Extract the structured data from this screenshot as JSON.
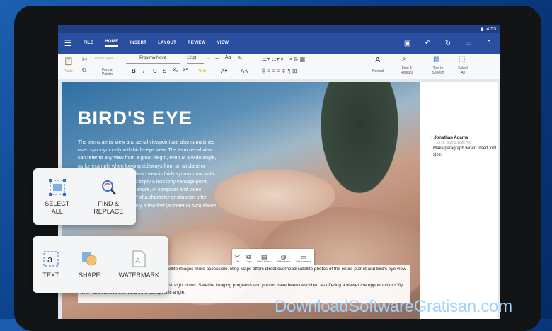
{
  "status": {
    "time": "4:53"
  },
  "menu": {
    "items": [
      "FILE",
      "HOME",
      "INSERT",
      "LAYOUT",
      "REVIEW",
      "VIEW"
    ]
  },
  "ribbon": {
    "paste": "Paste",
    "paste_style": "Paste Style",
    "format_painter": "Format Painter",
    "font_name": "Proxima Nova",
    "font_size": "12 pt",
    "style_normal": "Normal",
    "find_replace": "Find & Replace",
    "text_to_speech": "Text to Speech",
    "select_all": "Select All"
  },
  "document": {
    "title": "BIRD'S EYE",
    "body": "The terms aerial view and aerial viewpoint are also sometimes used synonymously with bird's-eye view. The term aerial view can refer to any view from a great height, even at a wide angle, as for example when looking sideways from an airplane or from a mountain top. Overhead view is fairly synonymous with bird's-eye view but tends to imply a less lofty vantage point than the latter term. For example, in computer and video games, an \"overhead view\" of a character or situation often places the vantage point only a few feet (a meter or two) above human height.",
    "lower_text_1": "Technological developments have made satellite images more accessible. Bing Maps offers direct overhead satellite photos of the entire planet and bird's eye view in some locations.",
    "lower_text_2": "Typically from 45 degrees rather than being straight down. Satellite imaging programs and photos have been described as offering a viewer the opportunity to \"fly over\" and observe the world from this specific angle."
  },
  "context_menu": [
    "Cut",
    "Copy",
    "Word lookup",
    "Web search",
    "Add comment"
  ],
  "comment": {
    "author": "Jonathan Adams",
    "date": "Jul 16, 2020 1:48:48 PM",
    "text": "Make paragraph wider. Insert font size."
  },
  "card_select": {
    "select_all": "SELECT ALL",
    "find_replace": "FIND & REPLACE"
  },
  "card_insert": {
    "text": "TEXT",
    "shape": "SHAPE",
    "watermark": "WATERMARK"
  },
  "site_watermark": "DownloadSoftwareGratisan.com",
  "colors": {
    "accent": "#2a4fa0",
    "icon_blue": "#3a6fd0"
  }
}
